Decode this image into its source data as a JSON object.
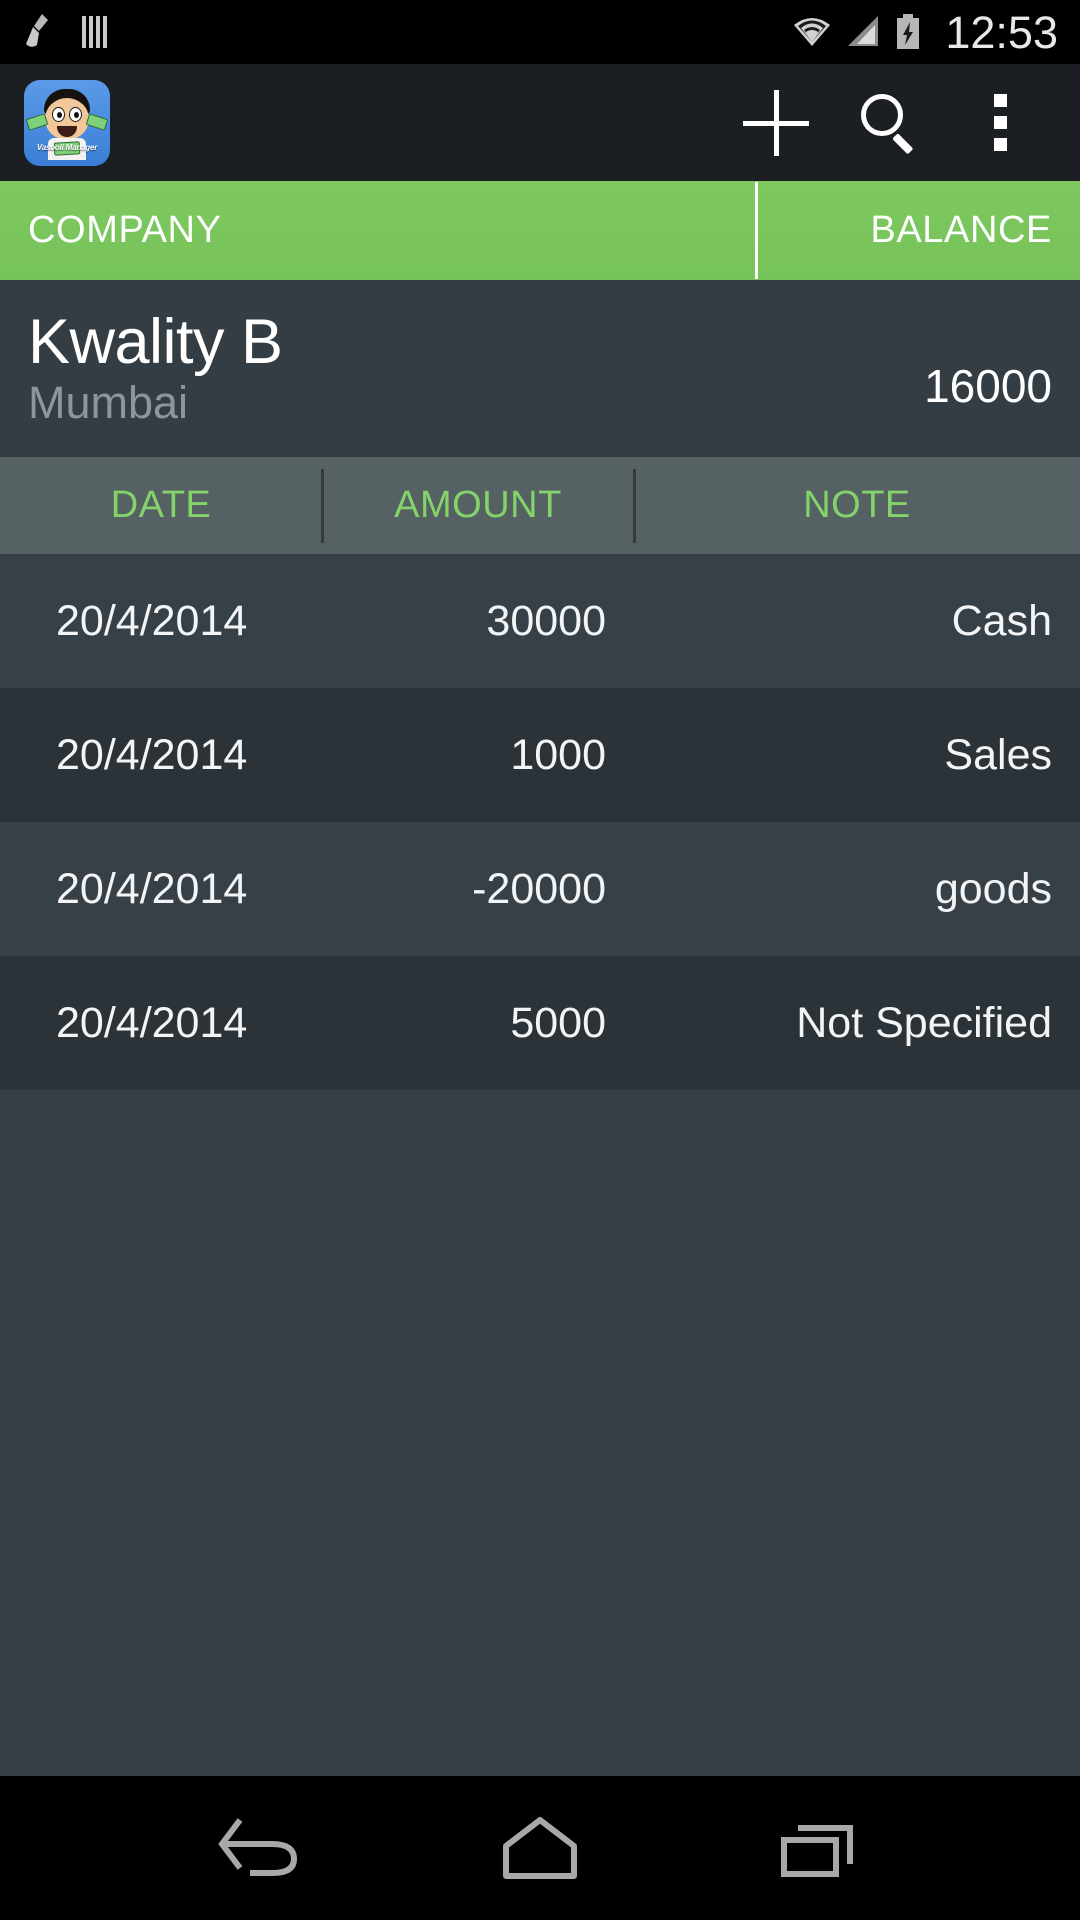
{
  "status_bar": {
    "icons": [
      "cleaner-broom-icon",
      "barcode-icon",
      "wifi-icon",
      "cellular-signal-icon",
      "battery-charging-icon"
    ],
    "time": "12:53"
  },
  "action_bar": {
    "app_logo_caption": "Vasooli Manager",
    "add_label": "+",
    "actions": [
      "add-icon",
      "search-icon",
      "overflow-menu-icon"
    ]
  },
  "column_header": {
    "company": "COMPANY",
    "balance": "BALANCE"
  },
  "company": {
    "name": "Kwality B",
    "city": "Mumbai",
    "balance": "16000"
  },
  "transactions_table": {
    "columns": [
      "DATE",
      "AMOUNT",
      "NOTE"
    ],
    "rows": [
      {
        "date": "20/4/2014",
        "amount": "30000",
        "note": "Cash"
      },
      {
        "date": "20/4/2014",
        "amount": "1000",
        "note": "Sales"
      },
      {
        "date": "20/4/2014",
        "amount": "-20000",
        "note": "goods"
      },
      {
        "date": "20/4/2014",
        "amount": "5000",
        "note": "Not Specified"
      }
    ]
  },
  "nav_bar": {
    "buttons": [
      "back-icon",
      "home-icon",
      "recents-icon"
    ]
  },
  "colors": {
    "accent_green": "#7ec85f",
    "header_green_text": "#83d36a",
    "background_dark": "#363f46",
    "row_alt": "#2b3338",
    "table_head": "#566163",
    "action_bar": "#1b1f24"
  }
}
